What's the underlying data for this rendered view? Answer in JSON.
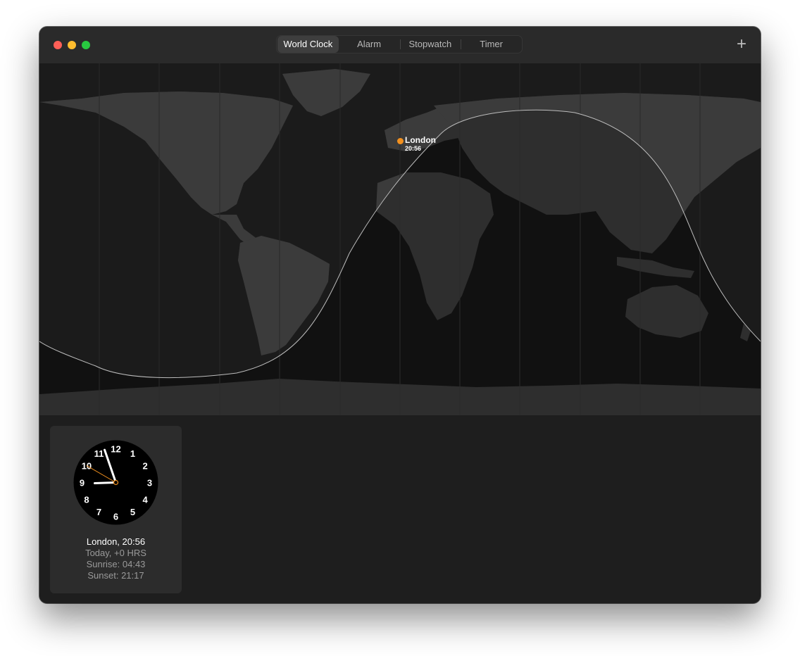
{
  "window": {
    "controls": [
      "close",
      "minimize",
      "zoom"
    ]
  },
  "tabs": [
    {
      "label": "World Clock",
      "active": true
    },
    {
      "label": "Alarm",
      "active": false
    },
    {
      "label": "Stopwatch",
      "active": false
    },
    {
      "label": "Timer",
      "active": false
    }
  ],
  "toolbar": {
    "add_label": "+"
  },
  "map": {
    "pin": {
      "city": "London",
      "time": "20:56"
    }
  },
  "clock_card": {
    "numerals": [
      "12",
      "1",
      "2",
      "3",
      "4",
      "5",
      "6",
      "7",
      "8",
      "9",
      "10",
      "11"
    ],
    "title": "London, 20:56",
    "day_offset": "Today, +0 HRS",
    "sunrise": "Sunrise: 04:43",
    "sunset": "Sunset: 21:17",
    "time": {
      "hour": 20,
      "minute": 56,
      "second": 50
    }
  },
  "colors": {
    "accent": "#f3911f",
    "land_day": "#3b3b3b",
    "land_night": "#2c2c2c",
    "ocean_day": "#1b1b1b",
    "ocean_night": "#111111"
  }
}
